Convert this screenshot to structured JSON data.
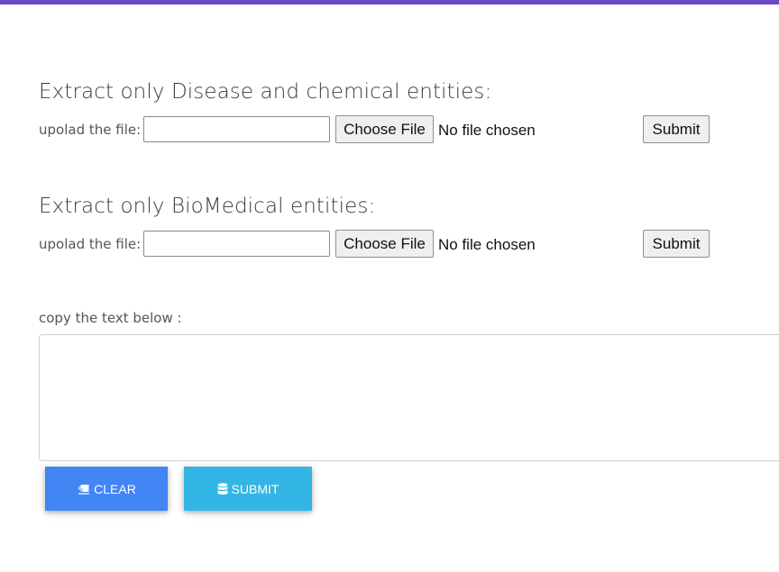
{
  "colors": {
    "top_bar": "#6c47c8",
    "clear_button": "#4285f4",
    "submit_button": "#33b5e5"
  },
  "sections": [
    {
      "title": "Extract only Disease and chemical entities:",
      "upload_label": "upolad the file:",
      "text_input_value": "",
      "choose_file_label": "Choose File",
      "file_status": "No file chosen",
      "submit_label": "Submit"
    },
    {
      "title": "Extract only BioMedical entities:",
      "upload_label": "upolad the file:",
      "text_input_value": "",
      "choose_file_label": "Choose File",
      "file_status": "No file chosen",
      "submit_label": "Submit"
    }
  ],
  "text_entry": {
    "label": "copy the text below :",
    "value": ""
  },
  "actions": {
    "clear": {
      "label": "CLEAR",
      "icon": "eraser-icon"
    },
    "submit": {
      "label": "SUBMIT",
      "icon": "database-icon"
    }
  }
}
